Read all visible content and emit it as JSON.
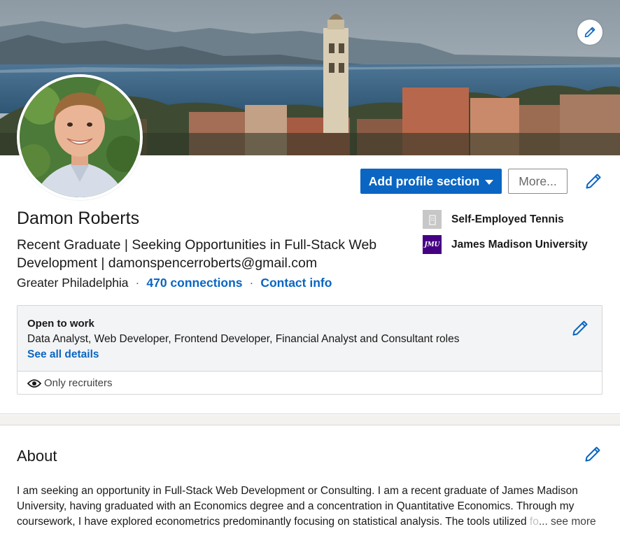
{
  "profile": {
    "name": "Damon Roberts",
    "headline": "Recent Graduate | Seeking Opportunities in Full-Stack Web Development | damonspencerroberts@gmail.com",
    "location": "Greater Philadelphia",
    "connections": "470 connections",
    "contact_info": "Contact info",
    "separator": "·"
  },
  "actions": {
    "add_profile_section": "Add profile section",
    "more": "More..."
  },
  "organizations": [
    {
      "name": "Self-Employed Tennis",
      "logo": "building-icon"
    },
    {
      "name": "James Madison University",
      "logo": "jmu-logo",
      "logo_text": "JMU"
    }
  ],
  "open_to_work": {
    "title": "Open to work",
    "roles": "Data Analyst, Web Developer, Frontend Developer, Financial Analyst and Consultant roles",
    "see_all": "See all details",
    "visibility": "Only recruiters"
  },
  "about": {
    "title": "About",
    "text_main": "I am seeking an opportunity in Full-Stack Web Development or Consulting. I am a recent graduate of James Madison University, having graduated with an Economics degree and a concentration in Quantitative Economics. Through my coursework, I have explored econometrics predominantly focusing on statistical analysis. The tools utilized ",
    "text_faded": "fo",
    "see_more": "... see more"
  },
  "colors": {
    "brand_blue": "#0a66c2",
    "jmu_purple": "#450084",
    "otw_background": "#f3f4f6"
  }
}
